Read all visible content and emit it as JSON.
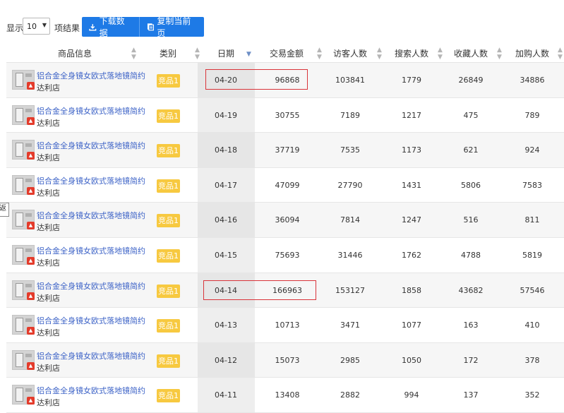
{
  "toolbar": {
    "show_label": "显示",
    "page_size": "10",
    "items_label": "项结果",
    "download_label": "下载数据",
    "copy_label": "复制当前页"
  },
  "table": {
    "headers": [
      "商品信息",
      "类别",
      "日期",
      "交易金额",
      "访客人数",
      "搜索人数",
      "收藏人数",
      "加购人数"
    ],
    "sorted_column": "日期",
    "rows": [
      {
        "name": "铝合金全身镜女欧式落地镜简约",
        "shop": "达利店",
        "category": "竞品1",
        "date": "04-20",
        "amount": "96868",
        "visitors": "103841",
        "searches": "1779",
        "favorites": "26849",
        "carts": "34886",
        "highlighted": true
      },
      {
        "name": "铝合金全身镜女欧式落地镜简约",
        "shop": "达利店",
        "category": "竞品1",
        "date": "04-19",
        "amount": "30755",
        "visitors": "7189",
        "searches": "1217",
        "favorites": "475",
        "carts": "789"
      },
      {
        "name": "铝合金全身镜女欧式落地镜简约",
        "shop": "达利店",
        "category": "竞品1",
        "date": "04-18",
        "amount": "37719",
        "visitors": "7535",
        "searches": "1173",
        "favorites": "621",
        "carts": "924"
      },
      {
        "name": "铝合金全身镜女欧式落地镜简约",
        "shop": "达利店",
        "category": "竞品1",
        "date": "04-17",
        "amount": "47099",
        "visitors": "27790",
        "searches": "1431",
        "favorites": "5806",
        "carts": "7583"
      },
      {
        "name": "铝合金全身镜女欧式落地镜简约",
        "shop": "达利店",
        "category": "竞品1",
        "date": "04-16",
        "amount": "36094",
        "visitors": "7814",
        "searches": "1247",
        "favorites": "516",
        "carts": "811"
      },
      {
        "name": "铝合金全身镜女欧式落地镜简约",
        "shop": "达利店",
        "category": "竞品1",
        "date": "04-15",
        "amount": "75693",
        "visitors": "31446",
        "searches": "1762",
        "favorites": "4788",
        "carts": "5819"
      },
      {
        "name": "铝合金全身镜女欧式落地镜简约",
        "shop": "达利店",
        "category": "竞品1",
        "date": "04-14",
        "amount": "166963",
        "visitors": "153127",
        "searches": "1858",
        "favorites": "43682",
        "carts": "57546",
        "highlighted": true
      },
      {
        "name": "铝合金全身镜女欧式落地镜简约",
        "shop": "达利店",
        "category": "竞品1",
        "date": "04-13",
        "amount": "10713",
        "visitors": "3471",
        "searches": "1077",
        "favorites": "163",
        "carts": "410"
      },
      {
        "name": "铝合金全身镜女欧式落地镜简约",
        "shop": "达利店",
        "category": "竞品1",
        "date": "04-12",
        "amount": "15073",
        "visitors": "2985",
        "searches": "1050",
        "favorites": "172",
        "carts": "378"
      },
      {
        "name": "铝合金全身镜女欧式落地镜简约",
        "shop": "达利店",
        "category": "竞品1",
        "date": "04-11",
        "amount": "13408",
        "visitors": "2882",
        "searches": "994",
        "favorites": "137",
        "carts": "352"
      }
    ]
  },
  "side_tab_label": "返",
  "colors": {
    "primary_button": "#1e7ae6",
    "category_badge": "#f7c940",
    "product_link": "#3d63c7",
    "highlight_box": "#d9343a"
  },
  "icons": {
    "download": "download-icon",
    "copy": "copy-icon",
    "sort": "sort-icon",
    "dropdown": "chevron-down-icon"
  }
}
